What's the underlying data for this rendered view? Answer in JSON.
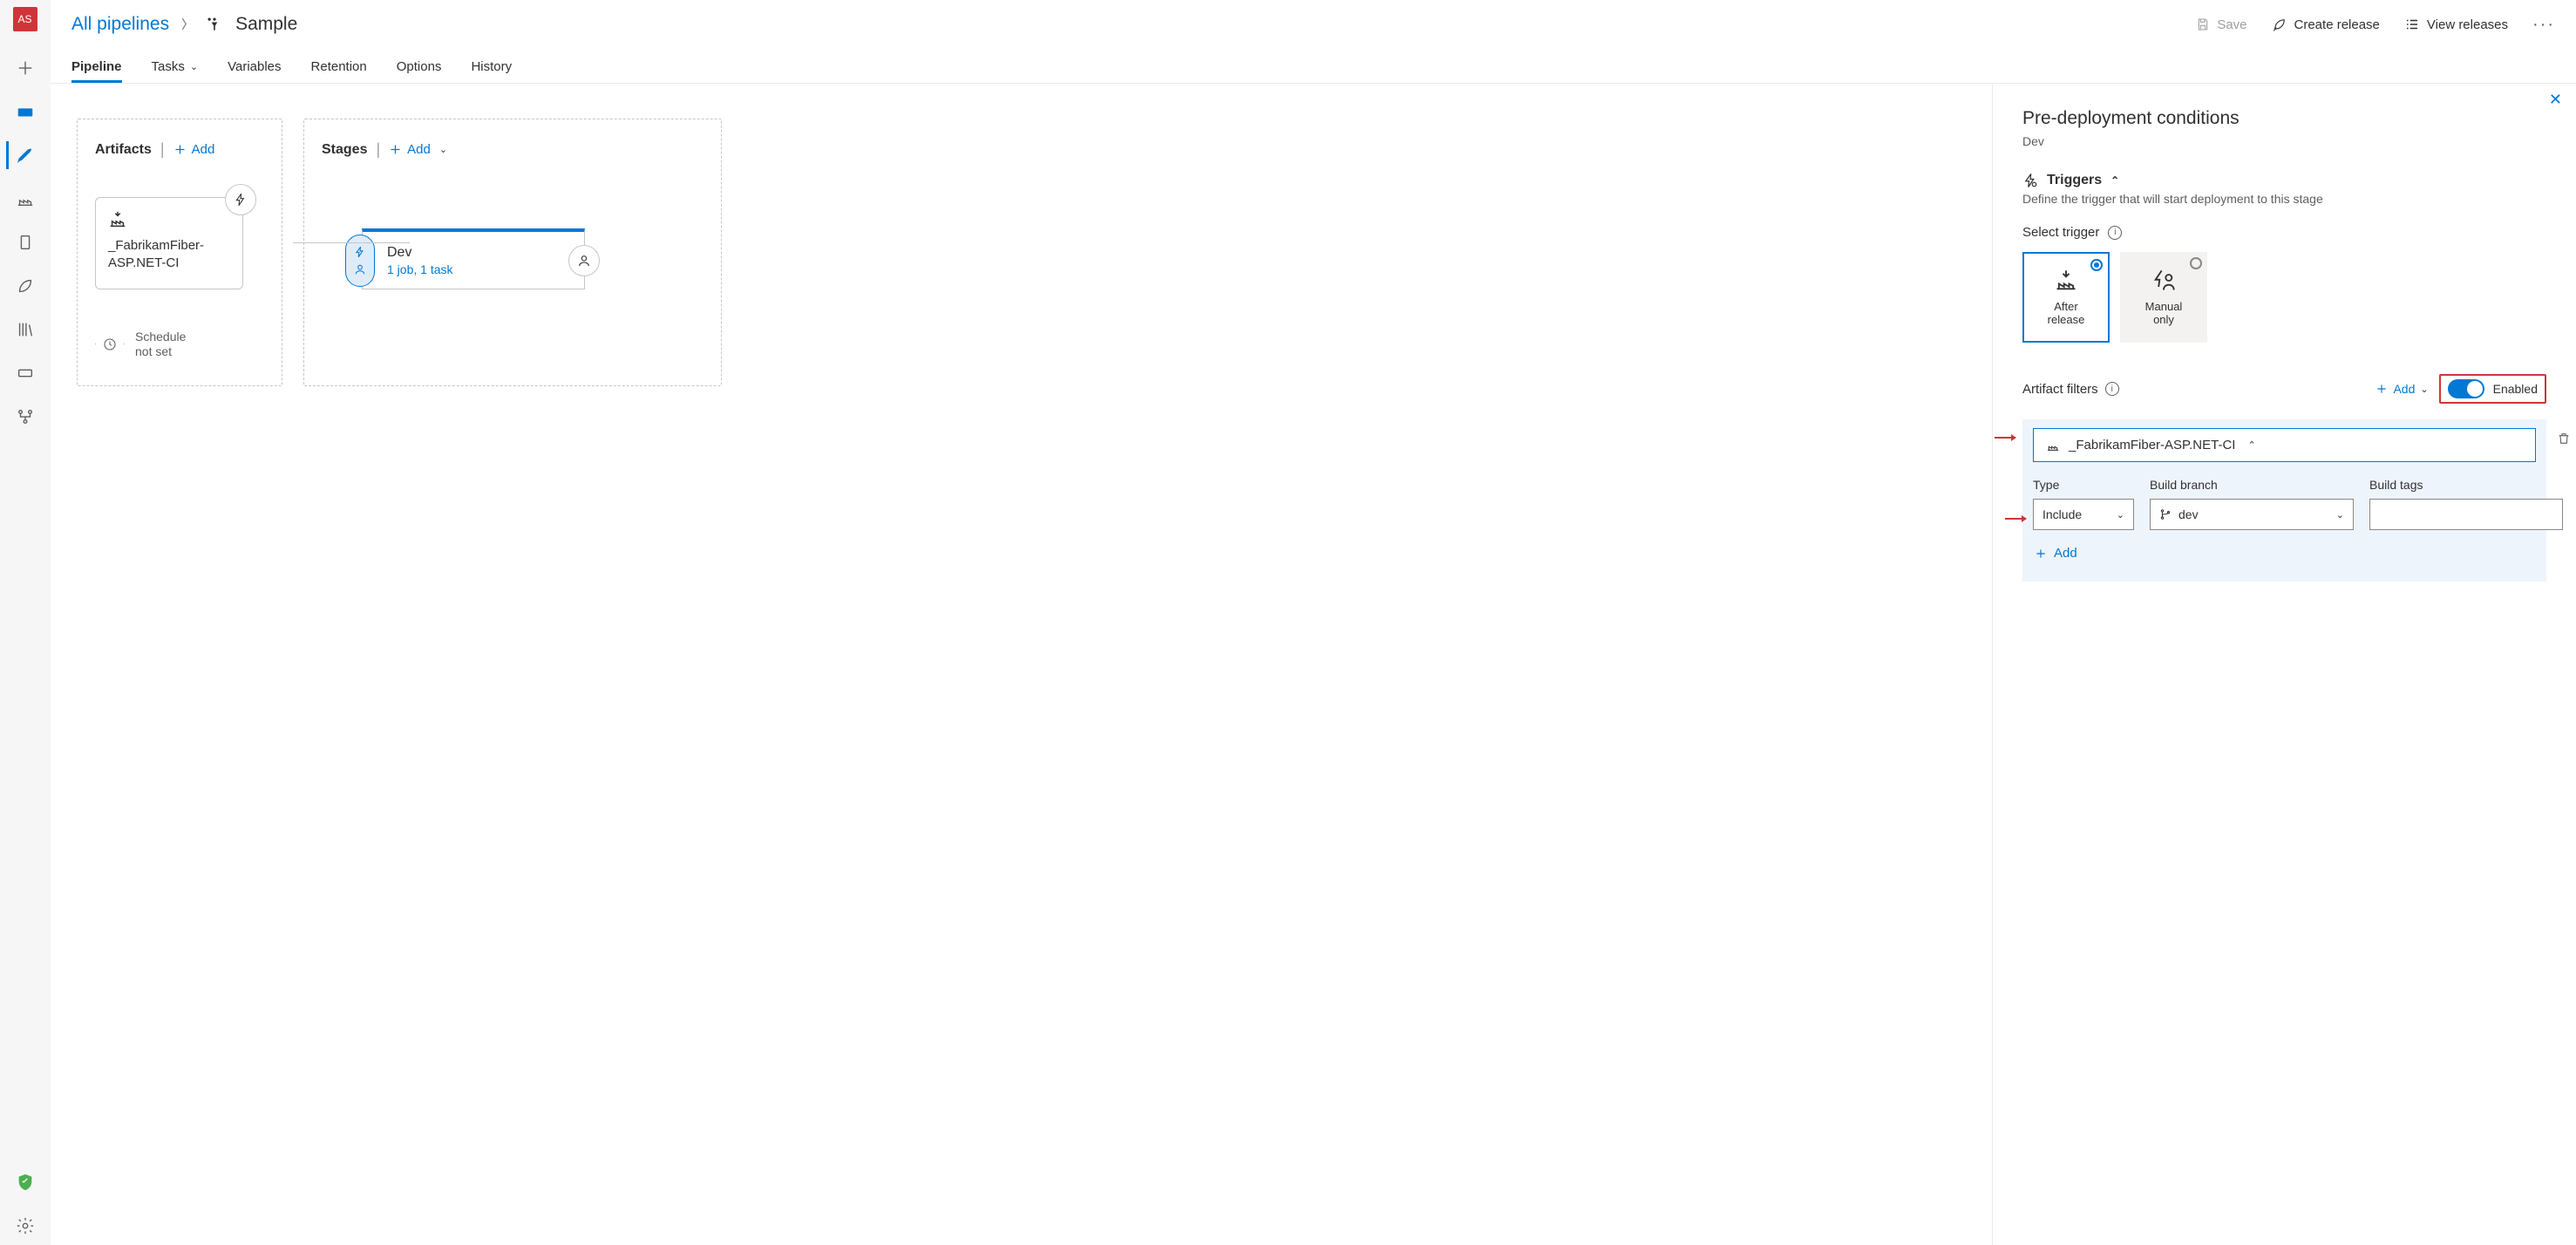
{
  "avatar_initials": "AS",
  "breadcrumb": {
    "root": "All pipelines",
    "name": "Sample"
  },
  "toolbar": {
    "save": "Save",
    "create_release": "Create release",
    "view_releases": "View releases"
  },
  "tabs": {
    "pipeline": "Pipeline",
    "tasks": "Tasks",
    "variables": "Variables",
    "retention": "Retention",
    "options": "Options",
    "history": "History"
  },
  "lanes": {
    "artifacts_title": "Artifacts",
    "stages_title": "Stages",
    "add": "Add"
  },
  "artifact": {
    "name": "_FabrikamFiber-ASP.NET-CI"
  },
  "schedule": {
    "line1": "Schedule",
    "line2": "not set"
  },
  "stage": {
    "name": "Dev",
    "sub": "1 job, 1 task"
  },
  "panel": {
    "title": "Pre-deployment conditions",
    "stage_name": "Dev",
    "triggers_title": "Triggers",
    "triggers_desc": "Define the trigger that will start deployment to this stage",
    "select_trigger": "Select trigger",
    "opt_after_l1": "After",
    "opt_after_l2": "release",
    "opt_manual_l1": "Manual",
    "opt_manual_l2": "only",
    "artifact_filters": "Artifact filters",
    "add": "Add",
    "enabled": "Enabled",
    "filter_artifact": "_FabrikamFiber-ASP.NET-CI",
    "col_type": "Type",
    "col_branch": "Build branch",
    "col_tags": "Build tags",
    "type_value": "Include",
    "branch_value": "dev",
    "add_sub": "Add"
  }
}
